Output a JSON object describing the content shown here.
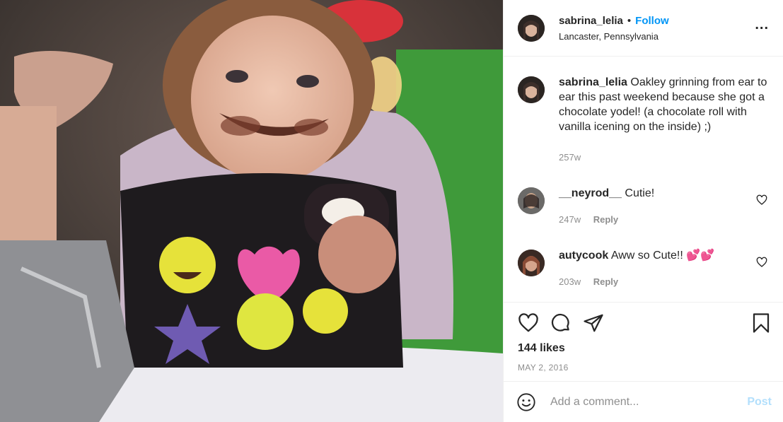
{
  "header": {
    "username": "sabrina_lelia",
    "dot": "•",
    "follow_label": "Follow",
    "location": "Lancaster, Pennsylvania",
    "more_label": "..."
  },
  "caption": {
    "username": "sabrina_lelia",
    "text": "Oakley grinning from ear to ear this past weekend because she got a chocolate yodel! (a chocolate roll with vanilla icening on the inside) ;)",
    "time": "257w"
  },
  "comments": [
    {
      "username": "__neyrod__",
      "text": "Cutie!",
      "time": "247w",
      "reply_label": "Reply"
    },
    {
      "username": "autycook",
      "text": "Aww so Cute!! ",
      "emoji": "💕💕",
      "time": "203w",
      "reply_label": "Reply"
    }
  ],
  "actions": {
    "icons": [
      "heart-icon",
      "comment-icon",
      "share-icon",
      "bookmark-icon"
    ],
    "likes": "144 likes",
    "date": "MAY 2, 2016"
  },
  "add_comment": {
    "placeholder": "Add a comment...",
    "post_label": "Post"
  },
  "colors": {
    "link": "#0095f6",
    "muted": "#8e8e8e",
    "post_disabled": "#b2dffc"
  }
}
